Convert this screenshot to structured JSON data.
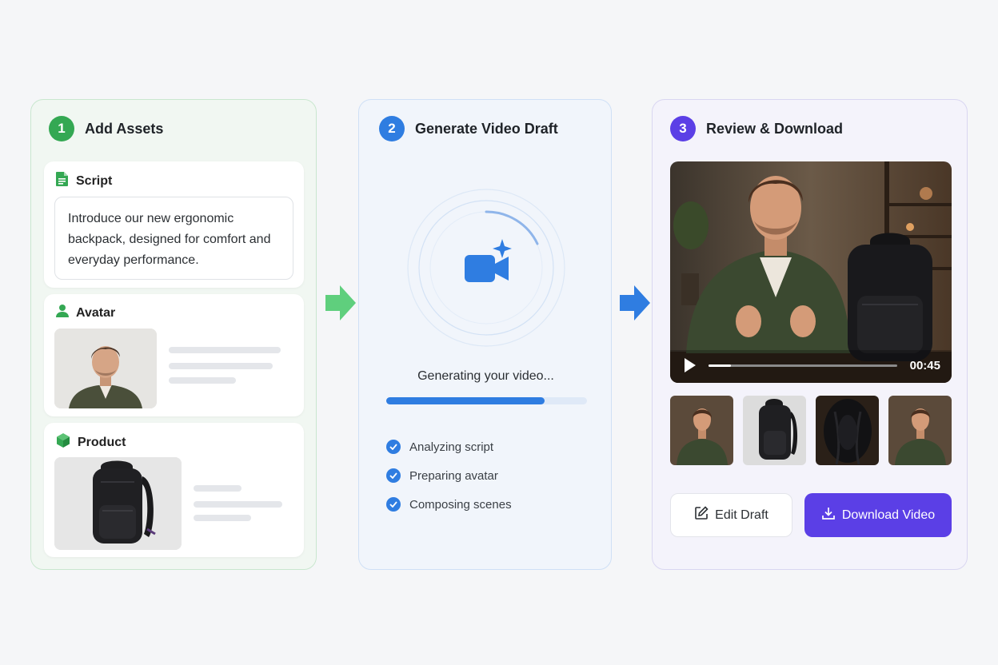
{
  "steps": [
    {
      "number": "1",
      "title": "Add Assets",
      "color": "#34a853"
    },
    {
      "number": "2",
      "title": "Generate Video Draft",
      "color": "#2f7de1"
    },
    {
      "number": "3",
      "title": "Review & Download",
      "color": "#5b3fe6"
    }
  ],
  "assets": {
    "script": {
      "label": "Script",
      "icon": "document-icon",
      "text": "Introduce our new ergonomic backpack, designed for comfort and everyday performance."
    },
    "avatar": {
      "label": "Avatar",
      "icon": "person-icon"
    },
    "product": {
      "label": "Product",
      "icon": "cube-icon"
    }
  },
  "generate": {
    "icon": "video-camera-sparkle-icon",
    "status": "Generating your video...",
    "progress": 0.8,
    "checks": [
      "Analyzing script",
      "Preparing avatar",
      "Composing scenes"
    ]
  },
  "review": {
    "video_time": "00:45",
    "video_progress": 0.12,
    "edit_label": "Edit Draft",
    "download_label": "Download Video"
  },
  "colors": {
    "green": "#34a853",
    "blue": "#2f7de1",
    "purple": "#5b3fe6"
  }
}
